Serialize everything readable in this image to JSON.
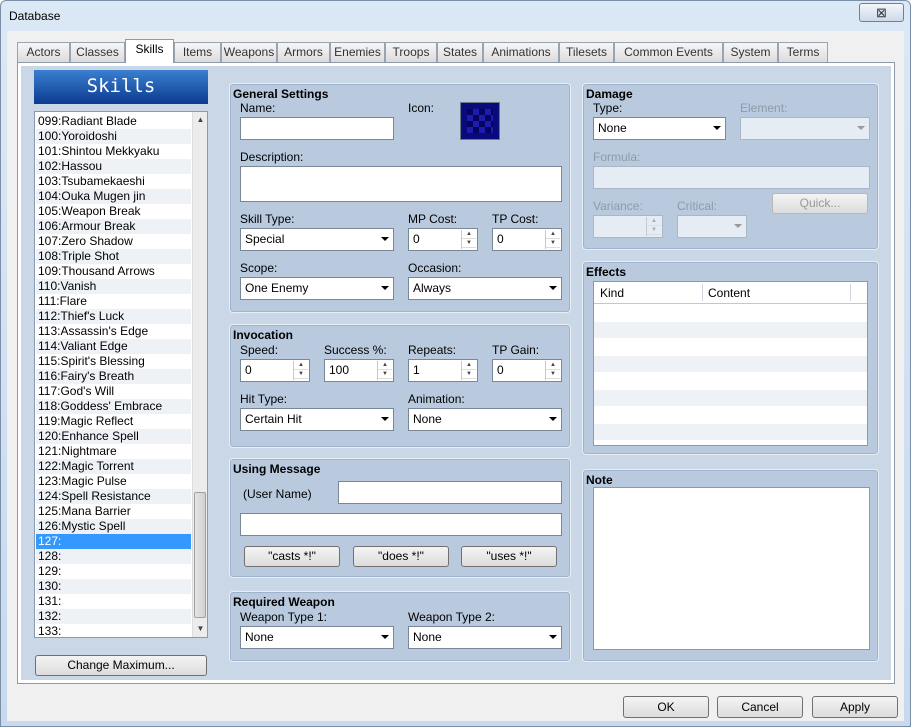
{
  "window": {
    "title": "Database",
    "close": "⊠"
  },
  "tabs": [
    "Actors",
    "Classes",
    "Skills",
    "Items",
    "Weapons",
    "Armors",
    "Enemies",
    "Troops",
    "States",
    "Animations",
    "Tilesets",
    "Common Events",
    "System",
    "Terms"
  ],
  "active_tab": "Skills",
  "panel_title": "Skills",
  "skill_list": [
    "099:Radiant Blade",
    "100:Yoroidoshi",
    "101:Shintou Mekkyaku",
    "102:Hassou",
    "103:Tsubamekaeshi",
    "104:Ouka Mugen jin",
    "105:Weapon Break",
    "106:Armour Break",
    "107:Zero Shadow",
    "108:Triple Shot",
    "109:Thousand Arrows",
    "110:Vanish",
    "111:Flare",
    "112:Thief's Luck",
    "113:Assassin's Edge",
    "114:Valiant Edge",
    "115:Spirit's Blessing",
    "116:Fairy's Breath",
    "117:God's Will",
    "118:Goddess' Embrace",
    "119:Magic Reflect",
    "120:Enhance Spell",
    "121:Nightmare",
    "122:Magic Torrent",
    "123:Magic Pulse",
    "124:Spell Resistance",
    "125:Mana Barrier",
    "126:Mystic Spell",
    "127:",
    "128:",
    "129:",
    "130:",
    "131:",
    "132:",
    "133:"
  ],
  "selected_index": 28,
  "change_max": "Change Maximum...",
  "general": {
    "title": "General Settings",
    "name_label": "Name:",
    "name_value": "",
    "icon_label": "Icon:",
    "desc_label": "Description:",
    "desc_value": "",
    "skill_type_label": "Skill Type:",
    "skill_type": "Special",
    "mp_label": "MP Cost:",
    "mp": "0",
    "tp_label": "TP Cost:",
    "tp": "0",
    "scope_label": "Scope:",
    "scope": "One Enemy",
    "occasion_label": "Occasion:",
    "occasion": "Always"
  },
  "invocation": {
    "title": "Invocation",
    "speed_label": "Speed:",
    "speed": "0",
    "success_label": "Success %:",
    "success": "100",
    "repeats_label": "Repeats:",
    "repeats": "1",
    "tpgain_label": "TP Gain:",
    "tpgain": "0",
    "hit_label": "Hit Type:",
    "hit": "Certain Hit",
    "anim_label": "Animation:",
    "anim": "None"
  },
  "message": {
    "title": "Using Message",
    "user_name": "(User Name)",
    "line1": "",
    "line2": "",
    "b1": "\"casts *!\"",
    "b2": "\"does *!\"",
    "b3": "\"uses *!\""
  },
  "weapon": {
    "title": "Required Weapon",
    "w1_label": "Weapon Type 1:",
    "w1": "None",
    "w2_label": "Weapon Type 2:",
    "w2": "None"
  },
  "damage": {
    "title": "Damage",
    "type_label": "Type:",
    "type": "None",
    "element_label": "Element:",
    "element": "",
    "formula_label": "Formula:",
    "formula": "",
    "variance_label": "Variance:",
    "variance": "",
    "critical_label": "Critical:",
    "critical": "",
    "quick": "Quick..."
  },
  "effects": {
    "title": "Effects",
    "col_kind": "Kind",
    "col_content": "Content"
  },
  "note": {
    "title": "Note",
    "value": ""
  },
  "footer": {
    "ok": "OK",
    "cancel": "Cancel",
    "apply": "Apply"
  }
}
